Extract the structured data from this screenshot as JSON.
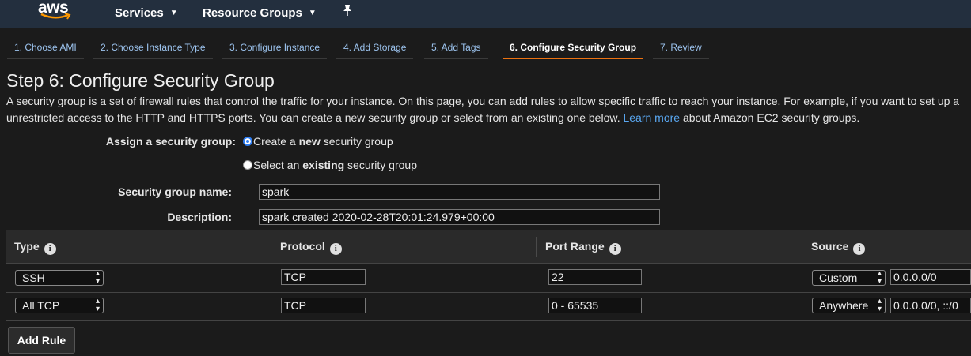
{
  "topnav": {
    "logo": "aws",
    "services": "Services",
    "resource_groups": "Resource Groups",
    "pin_icon": "pin-icon"
  },
  "tabs": [
    {
      "label": "1. Choose AMI"
    },
    {
      "label": "2. Choose Instance Type"
    },
    {
      "label": "3. Configure Instance"
    },
    {
      "label": "4. Add Storage"
    },
    {
      "label": "5. Add Tags"
    },
    {
      "label": "6. Configure Security Group",
      "active": true
    },
    {
      "label": "7. Review"
    }
  ],
  "page": {
    "title": "Step 6: Configure Security Group",
    "intro_line1": "A security group is a set of firewall rules that control the traffic for your instance. On this page, you can add rules to allow specific traffic to reach your instance. For example, if you want to set up a",
    "intro_line2_a": "unrestricted access to the HTTP and HTTPS ports. You can create a new security group or select from an existing one below.",
    "learn_more": "Learn more",
    "intro_line2_b": "about Amazon EC2 security groups."
  },
  "form": {
    "assign_label": "Assign a security group:",
    "option_new_pre": "Create a ",
    "option_new_bold": "new",
    "option_new_post": " security group",
    "option_existing_pre": "Select an ",
    "option_existing_bold": "existing",
    "option_existing_post": " security group",
    "name_label": "Security group name:",
    "name_value": "spark",
    "description_label": "Description:",
    "description_value": "spark created 2020-02-28T20:01:24.979+00:00"
  },
  "rules": {
    "headers": [
      "Type",
      "Protocol",
      "Port Range",
      "Source"
    ],
    "rows": [
      {
        "type": "SSH",
        "protocol": "TCP",
        "port_range": "22",
        "source": "Custom",
        "cidr": "0.0.0.0/0"
      },
      {
        "type": "All TCP",
        "protocol": "TCP",
        "port_range": "0 - 65535",
        "source": "Anywhere",
        "cidr": "0.0.0.0/0, ::/0"
      }
    ]
  },
  "add_rule": "Add Rule",
  "colors": {
    "nav_bg": "#232f3e",
    "active_tab_underline": "#ec7211",
    "link": "#5aa8f2",
    "radio_selected": "#2f7ff4"
  }
}
